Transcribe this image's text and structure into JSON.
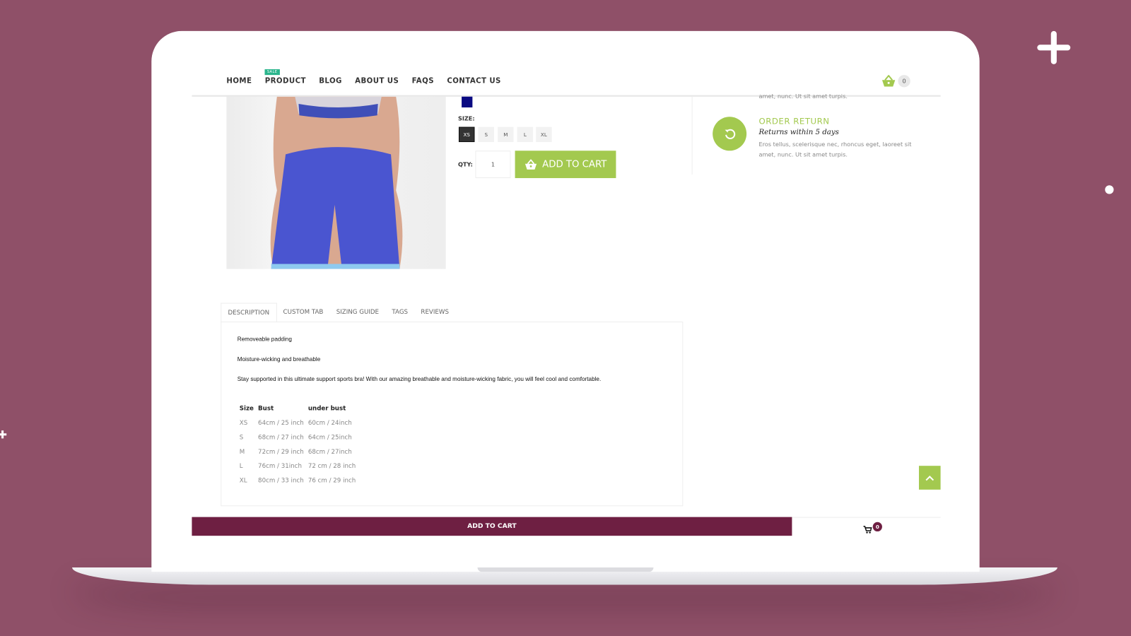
{
  "nav": {
    "items": [
      "HOME",
      "PRODUCT",
      "BLOG",
      "ABOUT US",
      "FAQS",
      "CONTACT US"
    ],
    "sale_badge": "SALE",
    "cart_count": "0"
  },
  "product": {
    "color_swatch": "#0a0a82",
    "size_label": "SIZE:",
    "sizes": [
      "XS",
      "S",
      "M",
      "L",
      "XL"
    ],
    "selected_size": "XS",
    "qty_label": "QTY:",
    "qty": "1",
    "add_to_cart": "ADD TO CART"
  },
  "features": {
    "prev_text_tail": "amet, nunc. Ut sit amet turpis.",
    "title": "ORDER RETURN",
    "subtitle": "Returns within 5 days",
    "text": "Eros tellus, scelerisque nec, rhoncus eget, laoreet sit amet, nunc. Ut sit amet turpis."
  },
  "tabs": [
    "DESCRIPTION",
    "CUSTOM TAB",
    "SIZING GUIDE",
    "TAGS",
    "REVIEWS"
  ],
  "description": {
    "p1": "Removeable padding",
    "p2": "Moisture-wicking and breathable",
    "p3": "Stay supported in this ultimate support sports bra! With our amazing breathable and moisture-wicking fabric, you will feel cool and comfortable.",
    "table": {
      "headers": [
        "Size",
        "Bust",
        "under bust"
      ],
      "rows": [
        [
          "XS",
          "64cm / 25 inch",
          "60cm / 24inch"
        ],
        [
          "S",
          "68cm / 27 inch",
          "64cm / 25inch"
        ],
        [
          "M",
          "72cm / 29 inch",
          "68cm / 27inch"
        ],
        [
          "L",
          "76cm / 31inch",
          "72 cm / 28 inch"
        ],
        [
          "XL",
          "80cm / 33 inch",
          "76 cm / 29 inch"
        ]
      ]
    }
  },
  "sticky": {
    "add_to_cart": "ADD TO CART",
    "cart_count": "0"
  },
  "colors": {
    "accent": "#a3c94f",
    "sticky_bar": "#6e1f42",
    "background": "#8f5068"
  }
}
